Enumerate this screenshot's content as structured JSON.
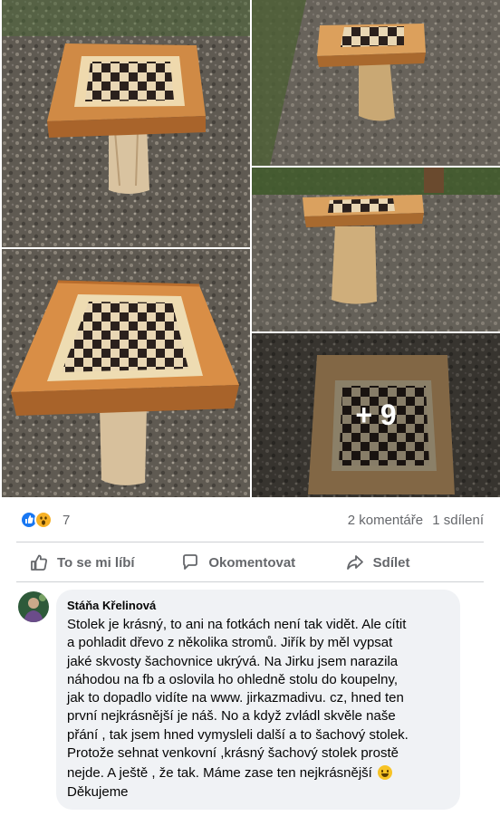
{
  "post": {
    "photos": [
      {
        "name": "chess-table-photo-1"
      },
      {
        "name": "chess-table-photo-2"
      },
      {
        "name": "chess-table-photo-3"
      },
      {
        "name": "chess-table-photo-4"
      },
      {
        "name": "chess-table-photo-5"
      }
    ],
    "more_photos_label": "+ 9"
  },
  "stats": {
    "reaction_icons": [
      "like-reaction-icon",
      "wow-reaction-icon"
    ],
    "reaction_count": "7",
    "comments": "2 komentáře",
    "shares": "1 sdílení"
  },
  "actions": {
    "like": "To se mi líbí",
    "comment": "Okomentovat",
    "share": "Sdílet"
  },
  "comment": {
    "author": "Stáňa Křelinová",
    "text": "Stolek je krásný, to ani na fotkách není tak vidět. Ale cítit\na pohladit dřevo z několika stromů. Jiřík by měl vypsat\njaké skvosty šachovnice ukrývá. Na Jirku jsem narazila\nnáhodou na fb a oslovila ho ohledně stolu do koupelny,\njak to dopadlo vidíte na www. jirkazmadivu. cz, hned ten\nprvní nejkrásnější je náš. No a když zvládl skvěle naše\npřání , tak jsem hned vymysleli další a to šachový stolek.\nProtože sehnat venkovní ,krásný šachový stolek prostě\nnejde. A ještě , že tak. Máme zase ten nejkrásnější",
    "text_end": "Děkujeme",
    "emoji": "grinning-emoji"
  },
  "colors": {
    "facebook_blue": "#1877f2",
    "wow_yellow": "#f7b125",
    "secondary_text": "#65676b",
    "bubble_bg": "#f0f2f5",
    "wood": "#c8843e"
  }
}
